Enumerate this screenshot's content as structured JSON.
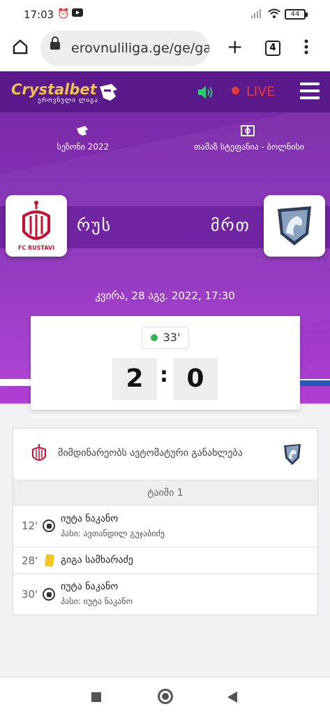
{
  "status_bar": {
    "time": "17:03",
    "battery": "44"
  },
  "browser": {
    "url": "erovnuliliga.ge/ge/gar",
    "tabs_count": "4"
  },
  "header": {
    "brand": "Crystalbet",
    "brand_sub": "ეროვნული ლიგა",
    "live_label": "LIVE"
  },
  "match": {
    "season_label": "სეზონი 2022",
    "stadium_label": "თამაზ სტეფანია - ბოლნისი",
    "home_team": {
      "short_name": "რუს",
      "badge_text": "FC RUSTAVI"
    },
    "away_team": {
      "short_name": "მრთ"
    },
    "datetime": "კვირა, 28 აგვ. 2022, 17:30",
    "minute": "33'",
    "home_score": "2",
    "away_score": "0"
  },
  "events_panel": {
    "auto_update_text": "მიმდინარეობს ავტომატური განახლება",
    "half_label": "ტაიმი 1",
    "events": [
      {
        "minute": "12'",
        "icon": "football-icon",
        "player": "იუტა ნაკანო",
        "assist": "პასი: ავთანდილ გუჯაბიძე"
      },
      {
        "minute": "28'",
        "icon": "yellow-card-icon",
        "player": "გიგა სამხარაძე",
        "assist": ""
      },
      {
        "minute": "30'",
        "icon": "football-icon",
        "player": "იუტა ნაკანო",
        "assist": "პასი: იუტა ნაკანო"
      }
    ]
  },
  "colors": {
    "header_bg": "#5a1a8c",
    "hero_bg": "#8a32ba",
    "live_red": "#e53b34",
    "brand_gold": "#f0c34a",
    "live_dot_green": "#2fb84a"
  }
}
